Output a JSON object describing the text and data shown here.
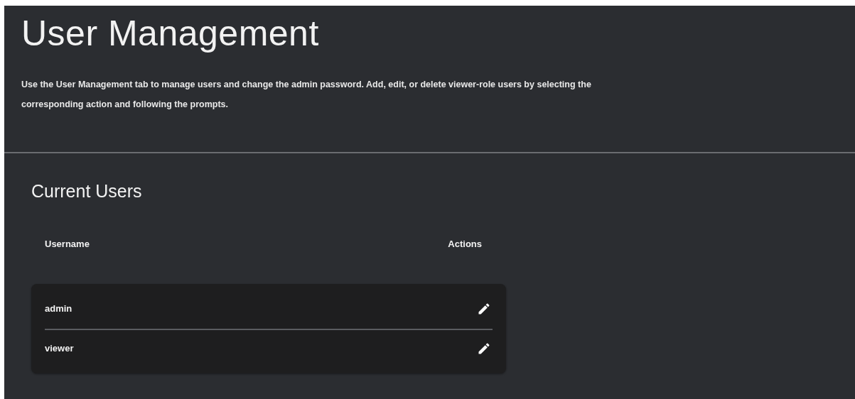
{
  "page": {
    "title": "User Management",
    "description": "Use the User Management tab to manage users and change the admin password. Add, edit, or delete viewer-role users by selecting the corresponding action and following the prompts."
  },
  "users_section": {
    "heading": "Current Users",
    "columns": [
      "Username",
      "Actions"
    ],
    "rows": [
      {
        "username": "admin"
      },
      {
        "username": "viewer"
      }
    ]
  }
}
